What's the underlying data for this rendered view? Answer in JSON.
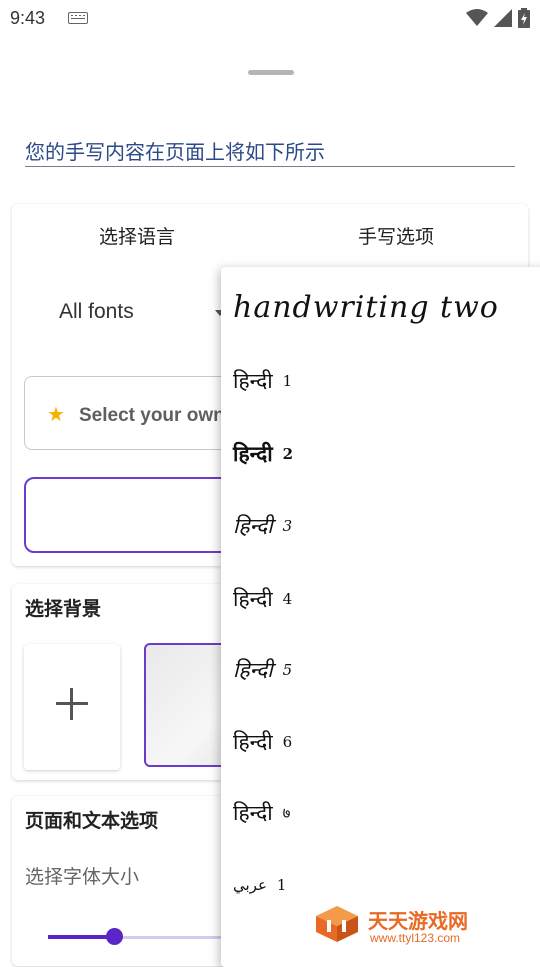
{
  "status_bar": {
    "time": "9:43",
    "icons": [
      "keyboard-icon",
      "wifi-icon",
      "signal-icon",
      "battery-icon"
    ]
  },
  "preview": {
    "text": "您的手写内容在页面上将如下所示"
  },
  "language_card": {
    "tabs": [
      {
        "label": "选择语言"
      },
      {
        "label": "手写选项"
      }
    ],
    "font_filter": {
      "selected": "All fonts"
    },
    "own_font_button": {
      "icon": "star-icon",
      "label": "Select your own"
    }
  },
  "background_card": {
    "title": "选择背景"
  },
  "page_card": {
    "title": "页面和文本选项",
    "font_size_label": "选择字体大小",
    "font_size_slider": {
      "value_fraction": 0.33
    }
  },
  "font_dropdown": {
    "items": [
      {
        "label": "handwriting two",
        "number": ""
      },
      {
        "label": "हिन्दी",
        "number": "1"
      },
      {
        "label": "हिन्दी",
        "number": "2"
      },
      {
        "label": "हिन्दी",
        "number": "3"
      },
      {
        "label": "हिन्दी",
        "number": "4"
      },
      {
        "label": "हिन्दी",
        "number": "5"
      },
      {
        "label": "हिन्दी",
        "number": "6"
      },
      {
        "label": "हिन्दी",
        "number": "७"
      },
      {
        "label": "عربي",
        "number": "1"
      }
    ]
  },
  "watermark": {
    "text": "天天游戏网",
    "url": "www.ttyl123.com"
  },
  "colors": {
    "accent": "#5b26c7",
    "preview_text": "#2c4a8a",
    "watermark": "#e86a25"
  }
}
